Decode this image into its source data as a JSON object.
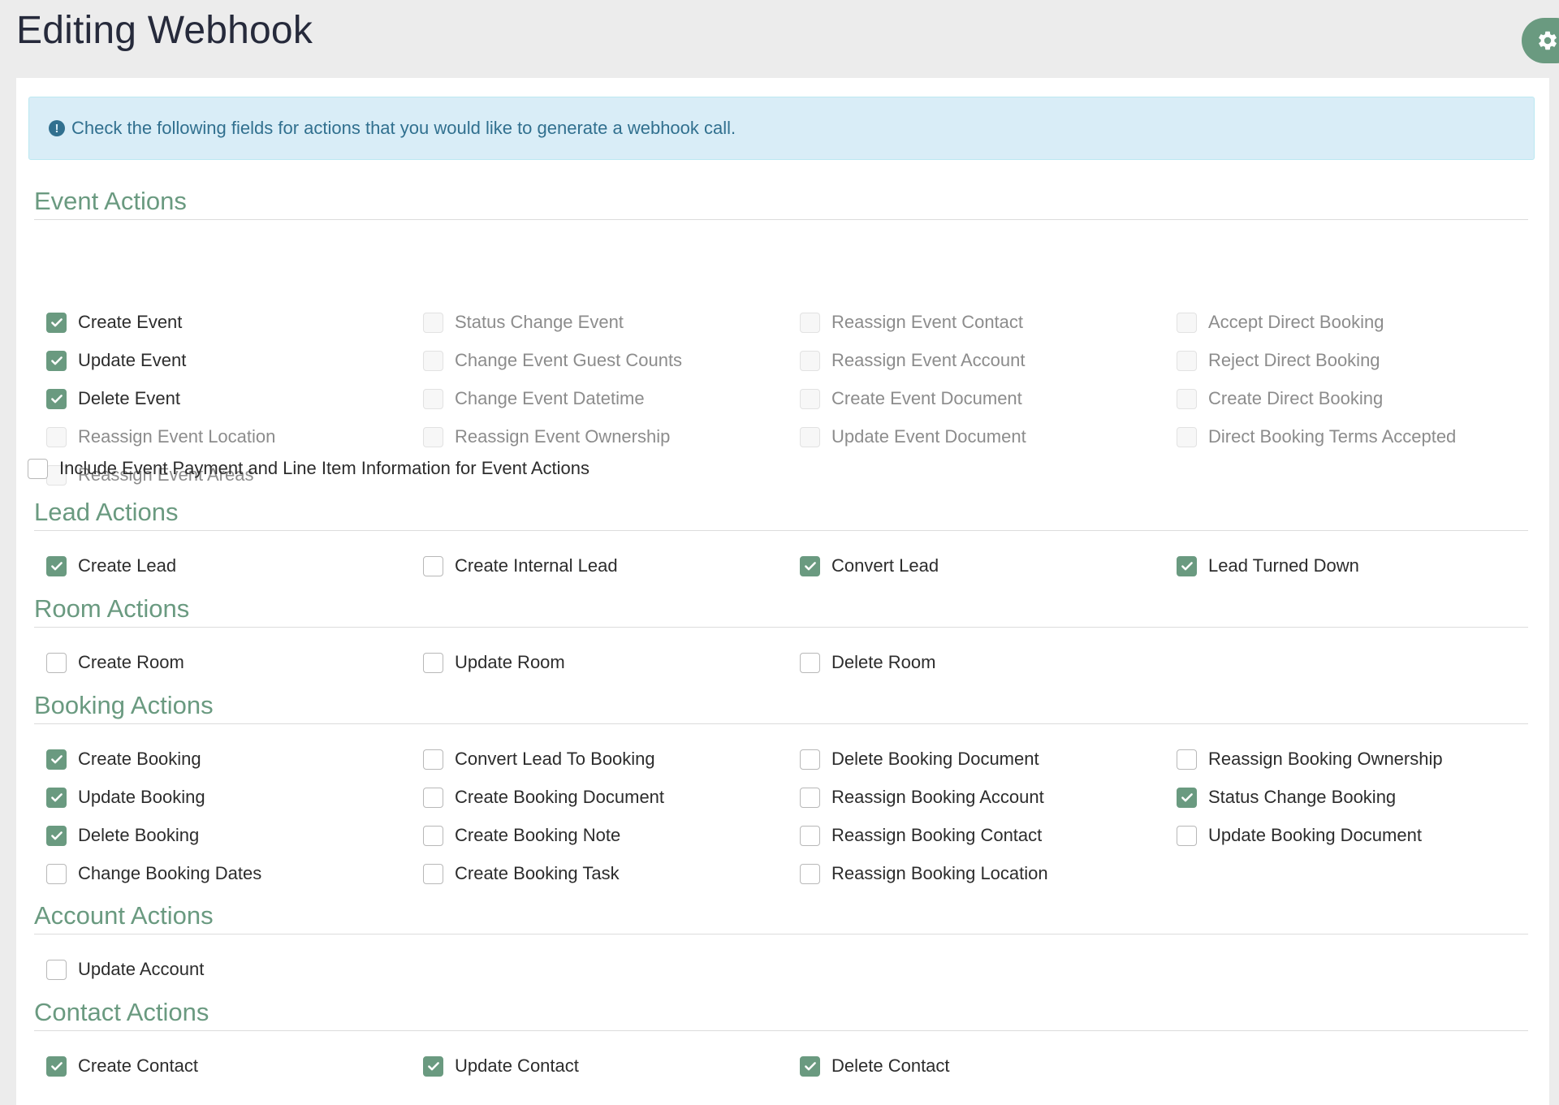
{
  "page": {
    "title": "Editing Webhook"
  },
  "colors": {
    "accent": "#6a9a80",
    "alert_bg": "#d9edf7",
    "alert_text": "#31708f"
  },
  "alert": {
    "icon": "info-icon",
    "message": "Check the following fields for actions that you would like to generate a webhook call."
  },
  "sections": {
    "event": {
      "title": "Event Actions",
      "items": [
        {
          "label": "Create Event",
          "checked": true,
          "disabled": false
        },
        {
          "label": "Status Change Event",
          "checked": false,
          "disabled": true
        },
        {
          "label": "Reassign Event Contact",
          "checked": false,
          "disabled": true
        },
        {
          "label": "Accept Direct Booking",
          "checked": false,
          "disabled": true
        },
        {
          "label": "Update Event",
          "checked": true,
          "disabled": false
        },
        {
          "label": "Change Event Guest Counts",
          "checked": false,
          "disabled": true
        },
        {
          "label": "Reassign Event Account",
          "checked": false,
          "disabled": true
        },
        {
          "label": "Reject Direct Booking",
          "checked": false,
          "disabled": true
        },
        {
          "label": "Delete Event",
          "checked": true,
          "disabled": false
        },
        {
          "label": "Change Event Datetime",
          "checked": false,
          "disabled": true
        },
        {
          "label": "Create Event Document",
          "checked": false,
          "disabled": true
        },
        {
          "label": "Create Direct Booking",
          "checked": false,
          "disabled": true
        },
        {
          "label": "Reassign Event Location",
          "checked": false,
          "disabled": true
        },
        {
          "label": "Reassign Event Ownership",
          "checked": false,
          "disabled": true
        },
        {
          "label": "Update Event Document",
          "checked": false,
          "disabled": true
        },
        {
          "label": "Direct Booking Terms Accepted",
          "checked": false,
          "disabled": true
        },
        {
          "label": "Reassign Event Areas",
          "checked": false,
          "disabled": true
        }
      ],
      "include_payment": {
        "label": "Include Event Payment and Line Item Information for Event Actions",
        "checked": false
      }
    },
    "lead": {
      "title": "Lead Actions",
      "items": [
        {
          "label": "Create Lead",
          "checked": true,
          "disabled": false
        },
        {
          "label": "Create Internal Lead",
          "checked": false,
          "disabled": false
        },
        {
          "label": "Convert Lead",
          "checked": true,
          "disabled": false
        },
        {
          "label": "Lead Turned Down",
          "checked": true,
          "disabled": false
        }
      ]
    },
    "room": {
      "title": "Room Actions",
      "items": [
        {
          "label": "Create Room",
          "checked": false,
          "disabled": false
        },
        {
          "label": "Update Room",
          "checked": false,
          "disabled": false
        },
        {
          "label": "Delete Room",
          "checked": false,
          "disabled": false
        }
      ]
    },
    "booking": {
      "title": "Booking Actions",
      "items": [
        {
          "label": "Create Booking",
          "checked": true,
          "disabled": false
        },
        {
          "label": "Convert Lead To Booking",
          "checked": false,
          "disabled": false
        },
        {
          "label": "Delete Booking Document",
          "checked": false,
          "disabled": false
        },
        {
          "label": "Reassign Booking Ownership",
          "checked": false,
          "disabled": false
        },
        {
          "label": "Update Booking",
          "checked": true,
          "disabled": false
        },
        {
          "label": "Create Booking Document",
          "checked": false,
          "disabled": false
        },
        {
          "label": "Reassign Booking Account",
          "checked": false,
          "disabled": false
        },
        {
          "label": "Status Change Booking",
          "checked": true,
          "disabled": false
        },
        {
          "label": "Delete Booking",
          "checked": true,
          "disabled": false
        },
        {
          "label": "Create Booking Note",
          "checked": false,
          "disabled": false
        },
        {
          "label": "Reassign Booking Contact",
          "checked": false,
          "disabled": false
        },
        {
          "label": "Update Booking Document",
          "checked": false,
          "disabled": false
        },
        {
          "label": "Change Booking Dates",
          "checked": false,
          "disabled": false
        },
        {
          "label": "Create Booking Task",
          "checked": false,
          "disabled": false
        },
        {
          "label": "Reassign Booking Location",
          "checked": false,
          "disabled": false
        }
      ]
    },
    "account": {
      "title": "Account Actions",
      "items": [
        {
          "label": "Update Account",
          "checked": false,
          "disabled": false
        }
      ]
    },
    "contact": {
      "title": "Contact Actions",
      "items": [
        {
          "label": "Create Contact",
          "checked": true,
          "disabled": false
        },
        {
          "label": "Update Contact",
          "checked": true,
          "disabled": false
        },
        {
          "label": "Delete Contact",
          "checked": true,
          "disabled": false
        }
      ]
    }
  }
}
